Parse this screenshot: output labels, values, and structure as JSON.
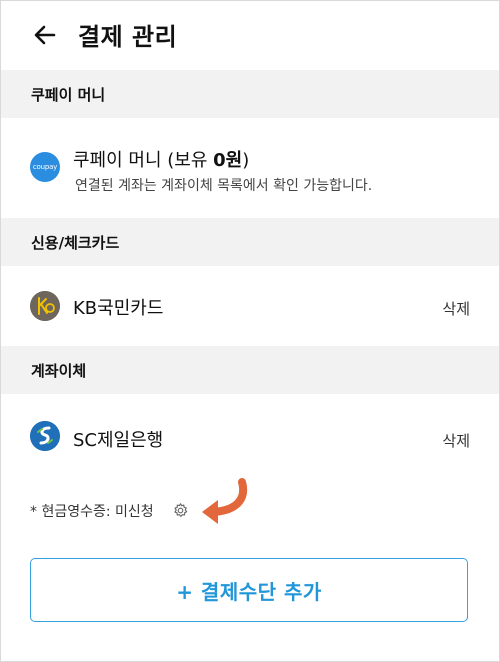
{
  "header": {
    "title": "결제 관리",
    "back_icon": "back-arrow-icon"
  },
  "coupay_section": {
    "title": "쿠페이 머니",
    "item": {
      "logo_text": "coupay",
      "name_prefix": "쿠페이 머니 (보유 ",
      "balance": "0원",
      "name_suffix": ")",
      "subtitle": "연결된 계좌는 계좌이체 목록에서 확인 가능합니다."
    }
  },
  "card_section": {
    "title": "신용/체크카드",
    "items": [
      {
        "name": "KB국민카드",
        "action": "삭제",
        "icon": "kb-card-logo-icon"
      }
    ]
  },
  "bank_section": {
    "title": "계좌이체",
    "items": [
      {
        "name": "SC제일은행",
        "action": "삭제",
        "icon": "sc-bank-logo-icon"
      }
    ]
  },
  "receipt": {
    "text": "* 현금영수증: 미신청",
    "icon": "gear-icon"
  },
  "add_button": {
    "label": "+ 결제수단 추가"
  },
  "colors": {
    "accent": "#2196d8",
    "button_border": "#36a3e0",
    "section_bg": "#f2f2f2",
    "annotation_arrow": "#e2673a",
    "coupay_blue": "#2a8de0",
    "kb_logo": "#6e665c",
    "sc_logo": "#1f70b8"
  }
}
